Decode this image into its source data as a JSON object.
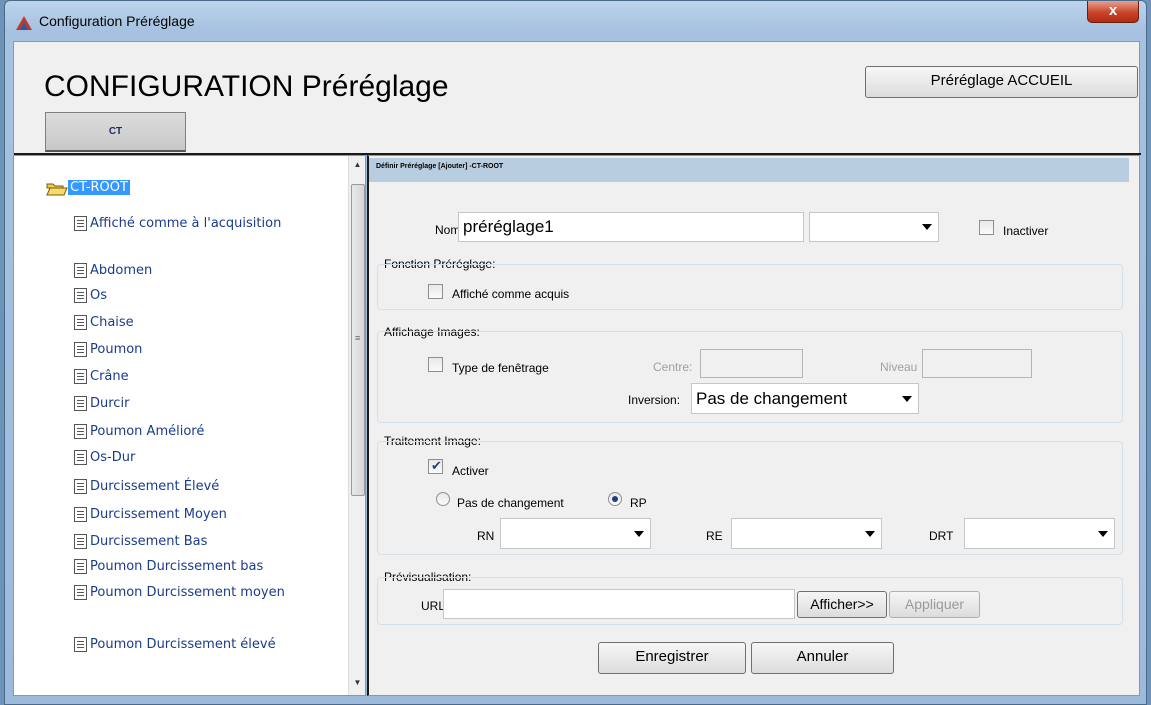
{
  "window": {
    "title": "Configuration Préréglage",
    "close_label": "x"
  },
  "header": {
    "title": "CONFIGURATION Préréglage",
    "tab_label": "CT",
    "home_button": "Préréglage ACCUEIL"
  },
  "tree": {
    "root": "CT-ROOT",
    "items": [
      "Affiché comme à l'acquisition",
      "Abdomen",
      "Os",
      "Chaise",
      "Poumon",
      "Crâne",
      "Durcir",
      "Poumon Amélioré",
      "Os-Dur",
      "Durcissement Élevé",
      "Durcissement Moyen",
      "Durcissement Bas",
      "Poumon Durcissement bas",
      "Poumon Durcissement moyen",
      "Poumon Durcissement élevé"
    ]
  },
  "form": {
    "header": "Définir Préréglage [Ajouter] -CT-ROOT",
    "name_label": "Nom",
    "name_value": "préréglage1",
    "name_select_value": "",
    "inactive_label": "Inactiver",
    "preset_function": {
      "title": "Fonction Préréglage:",
      "shown_as_acquired": "Affiché comme acquis"
    },
    "image_display": {
      "title": "Affichage Images:",
      "windowing_type": "Type de fenêtrage",
      "center_label": "Centre:",
      "center_value": "",
      "level_label": "Niveau",
      "level_value": "",
      "inversion_label": "Inversion:",
      "inversion_value": "Pas de changement"
    },
    "image_processing": {
      "title": "Traitement Image:",
      "enable_label": "Activer",
      "enable_checked": true,
      "radio_no_change": "Pas de changement",
      "radio_rp": "RP",
      "rn_label": "RN",
      "re_label": "RE",
      "drt_label": "DRT",
      "rn_value": "",
      "re_value": "",
      "drt_value": ""
    },
    "preview": {
      "title": "Prévisualisation:",
      "url_label": "URL:",
      "url_value": "",
      "show_button": "Afficher>>",
      "apply_button": "Appliquer"
    },
    "save_button": "Enregistrer",
    "cancel_button": "Annuler"
  },
  "colors": {
    "selection": "#3399ff",
    "form_header_bg": "#b8cde0",
    "tree_text": "#1a3c8a"
  }
}
